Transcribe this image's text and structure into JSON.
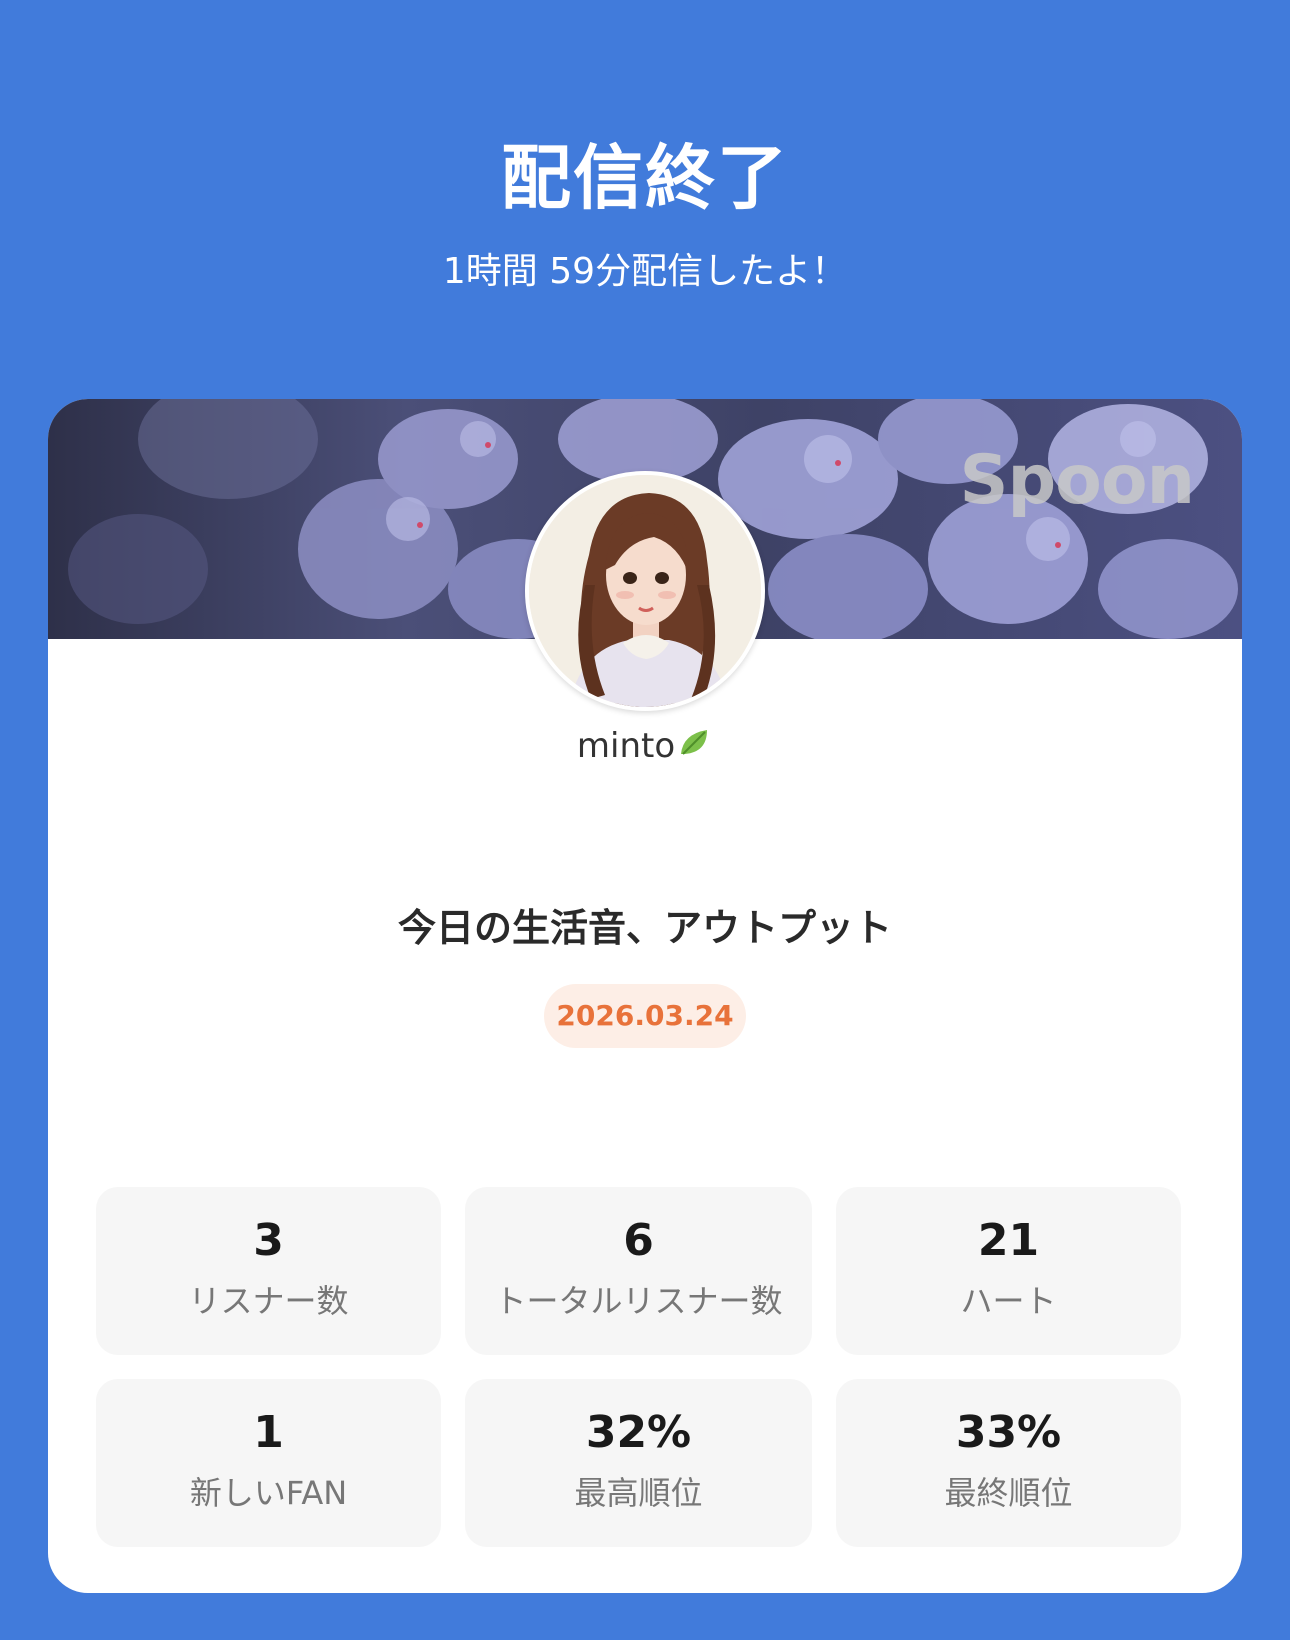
{
  "header": {
    "title": "配信終了",
    "subtitle": "1時間 59分配信したよ！"
  },
  "card": {
    "brand": "Spoon",
    "username": "minto",
    "username_emoji": "leaf-icon",
    "stream_title": "今日の生活音、アウトプット",
    "date": "2026.03.24"
  },
  "stats": [
    {
      "value": "3",
      "label": "リスナー数"
    },
    {
      "value": "6",
      "label": "トータルリスナー数"
    },
    {
      "value": "21",
      "label": "ハート"
    },
    {
      "value": "1",
      "label": "新しいFAN"
    },
    {
      "value": "32%",
      "label": "最高順位"
    },
    {
      "value": "33%",
      "label": "最終順位"
    }
  ],
  "colors": {
    "background": "#417bdb",
    "card": "#ffffff",
    "stat_box": "#f6f6f6",
    "date_badge_bg": "#fdeee6",
    "date_text": "#e8723a"
  }
}
